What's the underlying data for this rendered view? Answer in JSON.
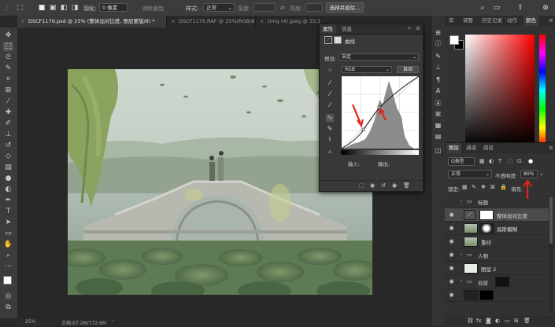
{
  "options_bar": {
    "feather_label": "羽化:",
    "feather_value": "0 像素",
    "antialias_label": "消除锯齿",
    "style_label": "样式:",
    "style_value": "正常",
    "width_label": "宽度:",
    "height_label": "高度:",
    "select_mask_button": "选择并遮住..."
  },
  "tabs": [
    {
      "close": "×",
      "label": "DSCF1176.psd @ 25% (整体加对比度, 图层蒙版/8) *"
    },
    {
      "close": "×",
      "label": "DSCF1176.RAF @ 25%(RGB/8)"
    },
    {
      "close": "×",
      "label": "timg (4).jpeg @ 33.3%(RGB/8)"
    }
  ],
  "properties": {
    "tab_properties": "属性",
    "tab_info": "信息",
    "adjustment_name": "曲线",
    "preset_label": "预设:",
    "preset_value": "自定",
    "channel_value": "RGB",
    "auto_button": "自动",
    "input_label": "输入:",
    "output_label": "输出:"
  },
  "right_panels": {
    "tabs": [
      "库",
      "调整",
      "历史记录",
      "动作",
      "颜色"
    ],
    "active_tab": "颜色",
    "foreground_color": "#ffffff",
    "background_color": "#000000",
    "hue_color": "#ff0000"
  },
  "layers": {
    "tabs": [
      "图层",
      "通道",
      "路径"
    ],
    "filter_label": "Q类型",
    "blend_mode": "正常",
    "opacity_label": "不透明度:",
    "opacity_value": "80%",
    "lock_label": "锁定:",
    "fill_label": "填充:",
    "rows": [
      {
        "name": "标题",
        "kind": "folder"
      },
      {
        "name": "整体加对比度",
        "kind": "adjustment"
      },
      {
        "name": "高斯模糊",
        "kind": "image"
      },
      {
        "name": "重印",
        "kind": "image"
      },
      {
        "name": "人物",
        "kind": "folder"
      },
      {
        "name": "图层 2",
        "kind": "image"
      },
      {
        "name": "云层",
        "kind": "folder"
      }
    ]
  },
  "status": {
    "zoom": "25%",
    "doc_info": "文档:67.2M/772.6M"
  },
  "annotation_color": "#e2231a"
}
